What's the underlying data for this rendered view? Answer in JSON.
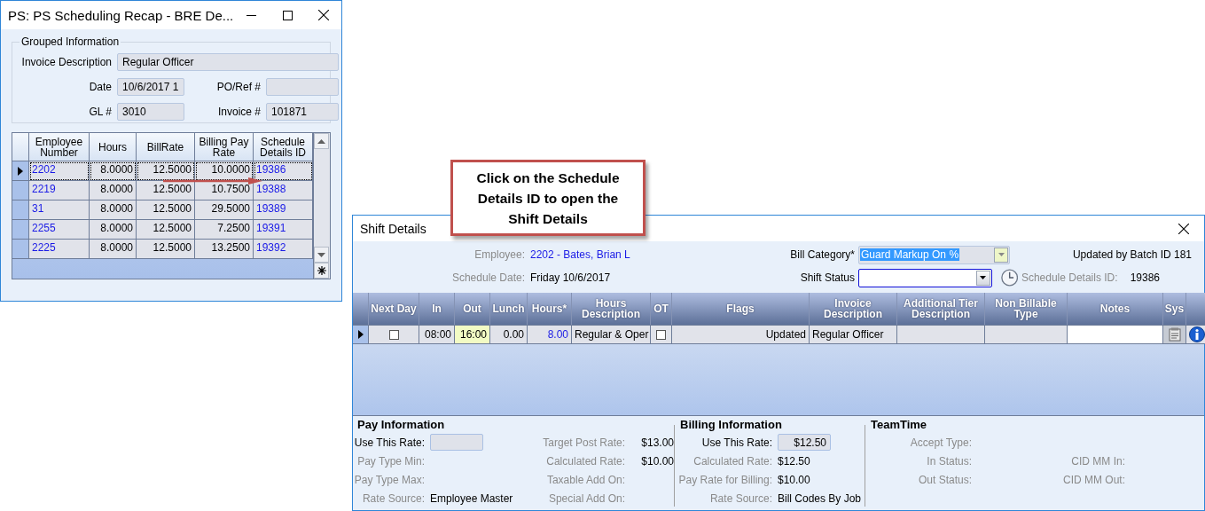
{
  "recap_window": {
    "title": "PS: PS Scheduling Recap - BRE De...",
    "group_title": "Grouped Information",
    "field_rows": [
      [
        {
          "label": "Invoice Description",
          "value": "Regular Officer"
        }
      ],
      [
        {
          "label": "Date",
          "value": "10/6/2017 1"
        },
        {
          "label": "PO/Ref #"
        }
      ],
      [
        {
          "label": "GL #",
          "value": "3010"
        },
        {
          "label": "Invoice #",
          "value": "101871"
        }
      ]
    ],
    "columns": [
      "Employee Number",
      "Hours",
      "BillRate",
      "Billing Pay Rate",
      "Schedule Details ID"
    ],
    "rows": [
      {
        "selected": true,
        "cells": [
          "2202",
          "8.0000",
          "12.5000",
          "10.0000",
          "19386"
        ]
      },
      {
        "selected": false,
        "cells": [
          "2219",
          "8.0000",
          "12.5000",
          "10.7500",
          "19388"
        ]
      },
      {
        "selected": false,
        "cells": [
          "31",
          "8.0000",
          "12.5000",
          "29.5000",
          "19389"
        ]
      },
      {
        "selected": false,
        "cells": [
          "2255",
          "8.0000",
          "12.5000",
          "7.2500",
          "19391"
        ]
      },
      {
        "selected": false,
        "cells": [
          "2225",
          "8.0000",
          "12.5000",
          "13.2500",
          "19392"
        ]
      }
    ]
  },
  "callout": {
    "text": "Click on the Schedule Details ID to open the Shift Details"
  },
  "shift_window": {
    "title": "Shift Details",
    "employee": {
      "label": "Employee:",
      "value": "2202 - Bates, Brian L"
    },
    "schedule_date": {
      "label": "Schedule Date:",
      "value": "Friday 10/6/2017"
    },
    "bill_category": {
      "label": "Bill Category*",
      "value": "Guard Markup On %"
    },
    "shift_status": {
      "label": "Shift Status"
    },
    "updated": "Updated by Batch ID 181",
    "schedule_details_id": {
      "label": "Schedule Details ID:",
      "value": "19386"
    },
    "columns": [
      "Next Day",
      "In",
      "Out",
      "Lunch",
      "Hours*",
      "Hours Description",
      "OT",
      "Flags",
      "Invoice Description",
      "Additional Tier Description",
      "Non Billable Type",
      "Notes",
      "Sys"
    ],
    "rows": [
      {
        "selected": true,
        "cells": [
          {
            "kind": "check",
            "checked": false
          },
          {
            "kind": "num",
            "text": "08:00"
          },
          {
            "kind": "num",
            "text": "16:00",
            "highlighted": true
          },
          {
            "kind": "num",
            "text": "0.00"
          },
          {
            "kind": "link",
            "text": "8.00"
          },
          {
            "kind": "text",
            "text": "Regular & Oper"
          },
          {
            "kind": "check",
            "checked": false
          },
          {
            "kind": "num",
            "text": "Updated"
          },
          {
            "kind": "text",
            "text": "Regular Officer"
          },
          {
            "kind": "empty"
          },
          {
            "kind": "empty"
          },
          {
            "kind": "notes"
          },
          {
            "kind": "sys"
          },
          {
            "kind": "info"
          }
        ]
      }
    ],
    "sections": [
      {
        "title": "Pay Information",
        "rows": [
          [
            {
              "kind": "input",
              "label": "Use This Rate:"
            },
            {
              "kind": "text",
              "label": "Target Post Rate:",
              "value": "$13.00"
            }
          ],
          [
            {
              "kind": "text",
              "label": "Pay Type Min:"
            },
            {
              "kind": "text",
              "label": "Calculated Rate:",
              "value": "$10.00"
            }
          ],
          [
            {
              "kind": "text",
              "label": "Pay Type Max:"
            },
            {
              "kind": "text",
              "label": "Taxable Add On:"
            }
          ],
          [
            {
              "kind": "text",
              "label": "Rate Source:",
              "value": "Employee Master"
            },
            {
              "kind": "text",
              "label": "Special Add On:"
            }
          ]
        ]
      },
      {
        "title": "Billing Information",
        "rows": [
          [
            {
              "kind": "input",
              "label": "Use This Rate:",
              "value": "$12.50"
            }
          ],
          [
            {
              "kind": "text",
              "label": "Calculated Rate:",
              "value": "$12.50"
            }
          ],
          [
            {
              "kind": "text",
              "label": "Pay Rate for Billing:",
              "value": "$10.00"
            }
          ],
          [
            {
              "kind": "text",
              "label": "Rate Source:",
              "value": "Bill Codes By Job"
            }
          ]
        ]
      },
      {
        "title": "TeamTime",
        "rows": [
          [
            {
              "kind": "text",
              "label": "Accept Type:"
            }
          ],
          [
            {
              "kind": "text",
              "label": "In Status:"
            },
            {
              "kind": "text",
              "label": "CID MM In:"
            }
          ],
          [
            {
              "kind": "text",
              "label": "Out Status:"
            },
            {
              "kind": "text",
              "label": "CID MM Out:"
            }
          ]
        ]
      }
    ]
  }
}
